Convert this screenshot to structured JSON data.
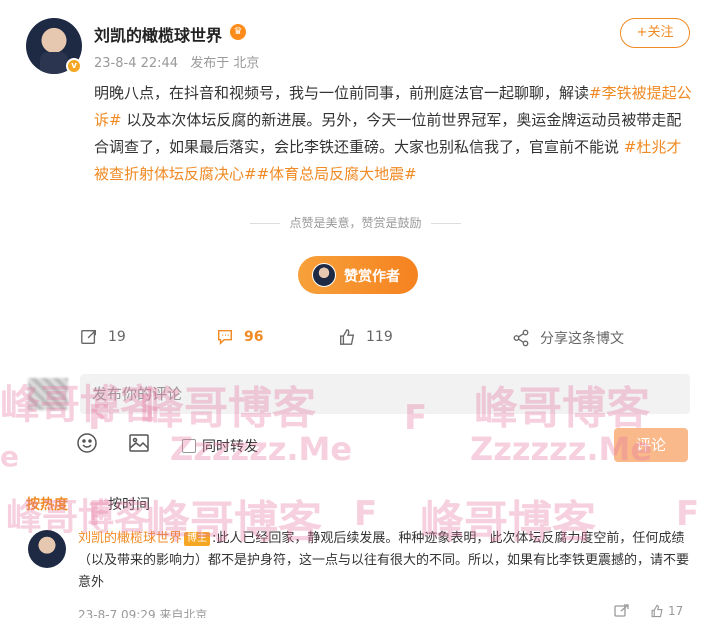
{
  "post": {
    "author": "刘凯的橄榄球世界",
    "verified_mark": "v",
    "timestamp": "23-8-4 22:44",
    "location": "发布于 北京",
    "follow_label": "+关注",
    "text_parts": [
      {
        "type": "text",
        "value": "明晚八点，在抖音和视频号，我与一位前同事，前刑庭法官一起聊聊，解读"
      },
      {
        "type": "tag",
        "value": "#李铁被提起公诉#"
      },
      {
        "type": "text",
        "value": " 以及本次体坛反腐的新进展。另外，今天一位前世界冠军，奥运金牌运动员被带走配合调查了，如果最后落实，会比李铁还重磅。大家也别私信我了，官宣前不能说 "
      },
      {
        "type": "tag",
        "value": "#杜兆才被查折射体坛反腐决心#"
      },
      {
        "type": "tag",
        "value": "#体育总局反腐大地震#"
      }
    ],
    "reward_caption": "点赞是美意，赞赏是鼓励",
    "reward_button": "赞赏作者"
  },
  "actions": {
    "repost_count": "19",
    "comment_count": "96",
    "like_count": "119",
    "share_label": "分享这条博文"
  },
  "compose": {
    "placeholder": "发布你的评论",
    "repost_label": "同时转发",
    "submit_label": "评论"
  },
  "sort": {
    "hot": "按热度",
    "time": "按时间"
  },
  "comment": {
    "author": "刘凯的橄榄球世界",
    "badge": "博主",
    "text": ":此人已经回家，静观后续发展。种种迹象表明，此次体坛反腐力度空前，任何成绩（以及带来的影响力）都不是护身符，这一点与以往有很大的不同。所以，如果有比李铁更震撼的，请不要意外",
    "meta": "23-8-7 09:29 来自北京",
    "like_count": "17"
  },
  "watermarks": {
    "brand": "峰哥博客",
    "letter": "F",
    "domain": "Zzzzzz.Me"
  },
  "colors": {
    "accent": "#f08a24",
    "watermark": "#e678a0"
  }
}
